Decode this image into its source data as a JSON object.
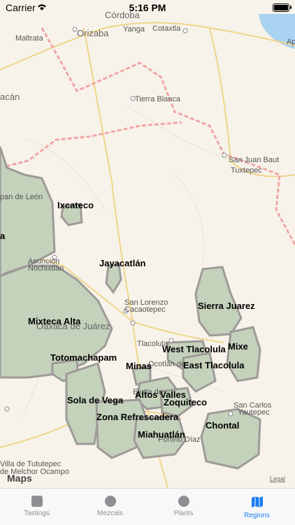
{
  "status": {
    "carrier": "Carrier",
    "time": "5:16 PM"
  },
  "map": {
    "regions": [
      {
        "name": "Ixcateco"
      },
      {
        "name": "Jayacatlán"
      },
      {
        "name": "Sierra Juarez"
      },
      {
        "name": "Mixteca Alta"
      },
      {
        "name": "West Tlacolula"
      },
      {
        "name": "Mixe"
      },
      {
        "name": "Totomachapam"
      },
      {
        "name": "Minas"
      },
      {
        "name": "East Tlacolula"
      },
      {
        "name": "Altos Valles"
      },
      {
        "name": "Zoquiteco"
      },
      {
        "name": "Sola de Vega"
      },
      {
        "name": "Zona Refrescadera"
      },
      {
        "name": "Chontal"
      },
      {
        "name": "Miahuatlán"
      }
    ],
    "cities": {
      "cordoba": "Córdoba",
      "orizaba": "Orizaba",
      "yanga": "Yanga",
      "cotaxtla": "Cotaxtla",
      "maltrata": "Maltrata",
      "tierra_blanca": "Tierra Blanca",
      "san_juan": "San Juan Baut",
      "tuxtepec": "Tuxtepec",
      "tehuacan": "acán",
      "pan_de_leon": "pan de León",
      "asuncion": "Asunción",
      "nochixtlan": "Nochixtlán",
      "san_lorenzo": "San Lorenzo",
      "cacaotepec": "Cacaotepec",
      "oaxaca": "Oaxaca de Juárez",
      "tlacolula": "Tlacolula",
      "san_carlos": "San Carlos",
      "yautepec": "Yautepec",
      "villa": "Villa de Tututepec",
      "melchor": "de Melchor Ocampo",
      "porfirio": "Porfirio Díaz",
      "ocotlan": "Ocotlán de",
      "ejutla": "Ejutla de",
      "ap": "Ap"
    },
    "maps_logo": "Maps",
    "legal": "Legal",
    "colors": {
      "region_fill": "#c4d1bb",
      "region_stroke": "#9e9a98"
    }
  },
  "tabs": [
    {
      "label": "Tastings",
      "icon": "square-icon"
    },
    {
      "label": "Mezcals",
      "icon": "circle-icon"
    },
    {
      "label": "Plants",
      "icon": "circle-icon"
    },
    {
      "label": "Regions",
      "icon": "map-icon",
      "active": true
    }
  ]
}
